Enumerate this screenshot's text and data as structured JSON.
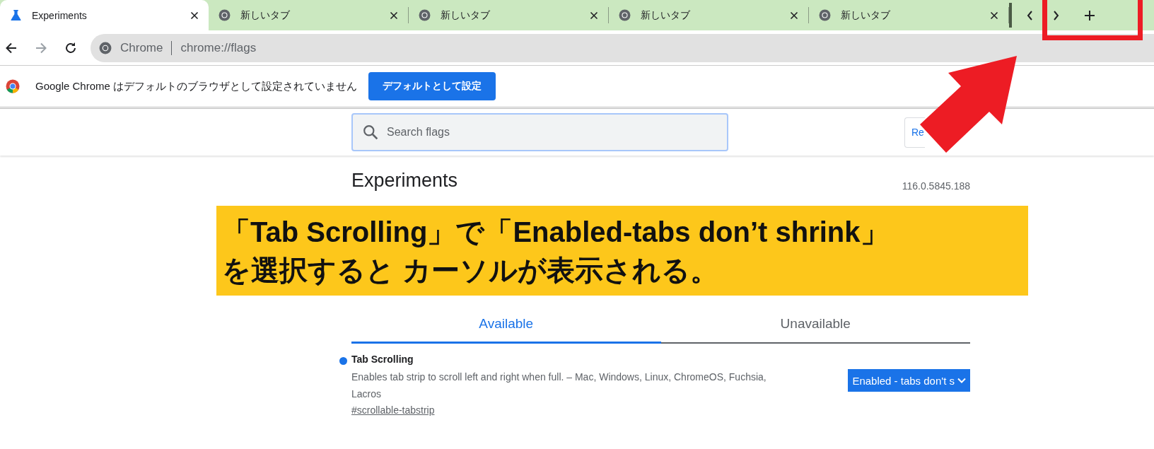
{
  "tabs": [
    {
      "title": "Experiments",
      "kind": "flask",
      "selected": true
    },
    {
      "title": "新しいタブ",
      "kind": "chrome",
      "selected": false
    },
    {
      "title": "新しいタブ",
      "kind": "chrome",
      "selected": false
    },
    {
      "title": "新しいタブ",
      "kind": "chrome",
      "selected": false
    },
    {
      "title": "新しいタブ",
      "kind": "chrome",
      "selected": false
    }
  ],
  "address_bar": {
    "site_label": "Chrome",
    "url": "chrome://flags"
  },
  "infobar": {
    "message": "Google Chrome はデフォルトのブラウザとして設定されていません",
    "button": "デフォルトとして設定"
  },
  "search": {
    "placeholder": "Search flags"
  },
  "reset_button": "Re",
  "heading": "Experiments",
  "version": "116.0.5845.188",
  "callout": [
    "「Tab Scrolling」で「Enabled-tabs don’t  shrink」",
    "を選択すると カーソルが表示される。"
  ],
  "view_tabs": [
    {
      "label": "Available",
      "selected": true
    },
    {
      "label": "Unavailable",
      "selected": false
    }
  ],
  "flags": [
    {
      "title": "Tab Scrolling",
      "modified": true,
      "description": "Enables tab strip to scroll left and right when full. – Mac, Windows, Linux, ChromeOS, Fuchsia, Lacros",
      "link": "#scrollable-tabstrip",
      "value": "Enabled - tabs don't s"
    }
  ]
}
